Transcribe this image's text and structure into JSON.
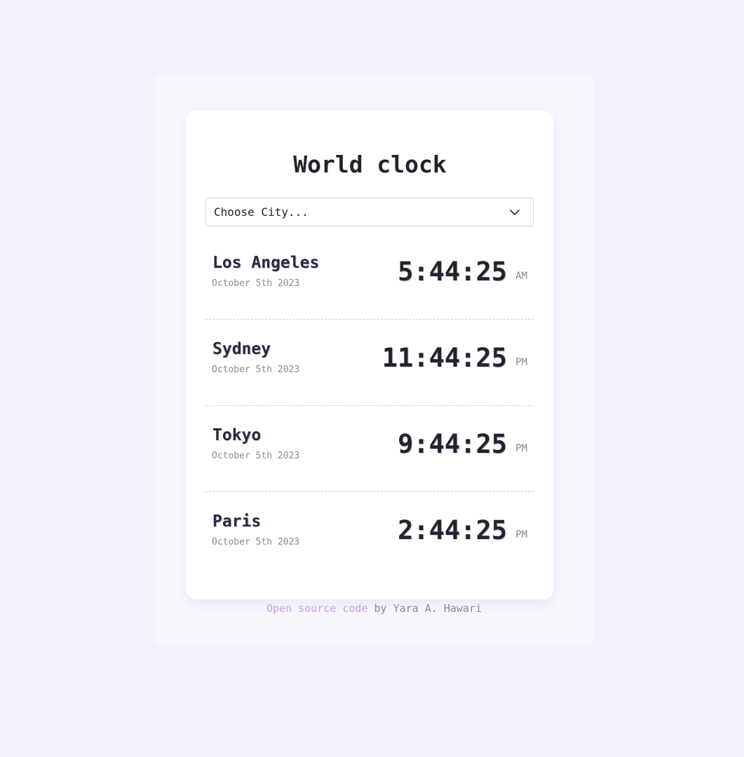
{
  "app": {
    "title": "World clock"
  },
  "city_select": {
    "selected": "Choose City...",
    "icon": "chevron-down-icon"
  },
  "cities": [
    {
      "name": "Los Angeles",
      "date": "October 5th 2023",
      "time": "5:44:25",
      "ampm": "AM"
    },
    {
      "name": "Sydney",
      "date": "October 5th 2023",
      "time": "11:44:25",
      "ampm": "PM"
    },
    {
      "name": "Tokyo",
      "date": "October 5th 2023",
      "time": "9:44:25",
      "ampm": "PM"
    },
    {
      "name": "Paris",
      "date": "October 5th 2023",
      "time": "2:44:25",
      "ampm": "PM"
    }
  ],
  "footer": {
    "link_text": "Open source code",
    "credit_text": " by Yara A. Hawari"
  },
  "colors": {
    "background": "#f4f2fd",
    "card": "#ffffff",
    "link": "#c59ff0",
    "text": "#22232a",
    "muted": "#8a8a92",
    "shadow_accent": "#c8c3ea"
  }
}
